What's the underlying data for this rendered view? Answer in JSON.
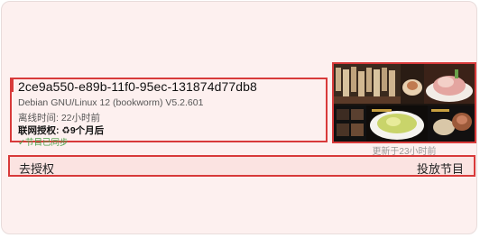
{
  "device": {
    "id": "2ce9a550-e89b-11f0-95ec-131874d77db8",
    "os": "Debian GNU/Linux 12 (bookworm) V5.2.601",
    "offline_label": "离线时间: 22小时前",
    "license_label": "联网授权:",
    "license_icon": "recycle-icon",
    "license_value": "9个月后",
    "sync_status": "节目已同步"
  },
  "thumbnail": {
    "updated_label": "更新于23小时前"
  },
  "actions": {
    "deauthorize_label": "去授权",
    "publish_label": "投放节目"
  },
  "colors": {
    "highlight": "#d83a3a",
    "card_bg": "#fdf0ef",
    "sync_green": "#4aa048"
  }
}
